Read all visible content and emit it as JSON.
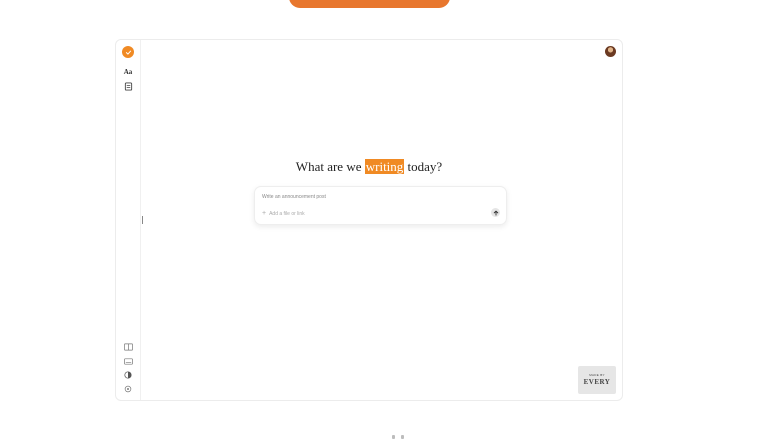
{
  "headline": {
    "prefix": "What are we",
    "highlight": "writing",
    "suffix": "today?"
  },
  "composer": {
    "placeholder": "Write an announcement post",
    "attach_label": "Add a file or link"
  },
  "sidebar": {
    "font_label": "Aa"
  },
  "badge": {
    "top": "MADE BY",
    "brand": "EVERY"
  },
  "colors": {
    "accent": "#f08a24",
    "banner": "#e8772e"
  },
  "icons": [
    "check-icon",
    "font-icon",
    "document-icon",
    "book-icon",
    "keyboard-icon",
    "contrast-icon",
    "settings-icon",
    "plus-icon",
    "arrow-up-icon"
  ]
}
